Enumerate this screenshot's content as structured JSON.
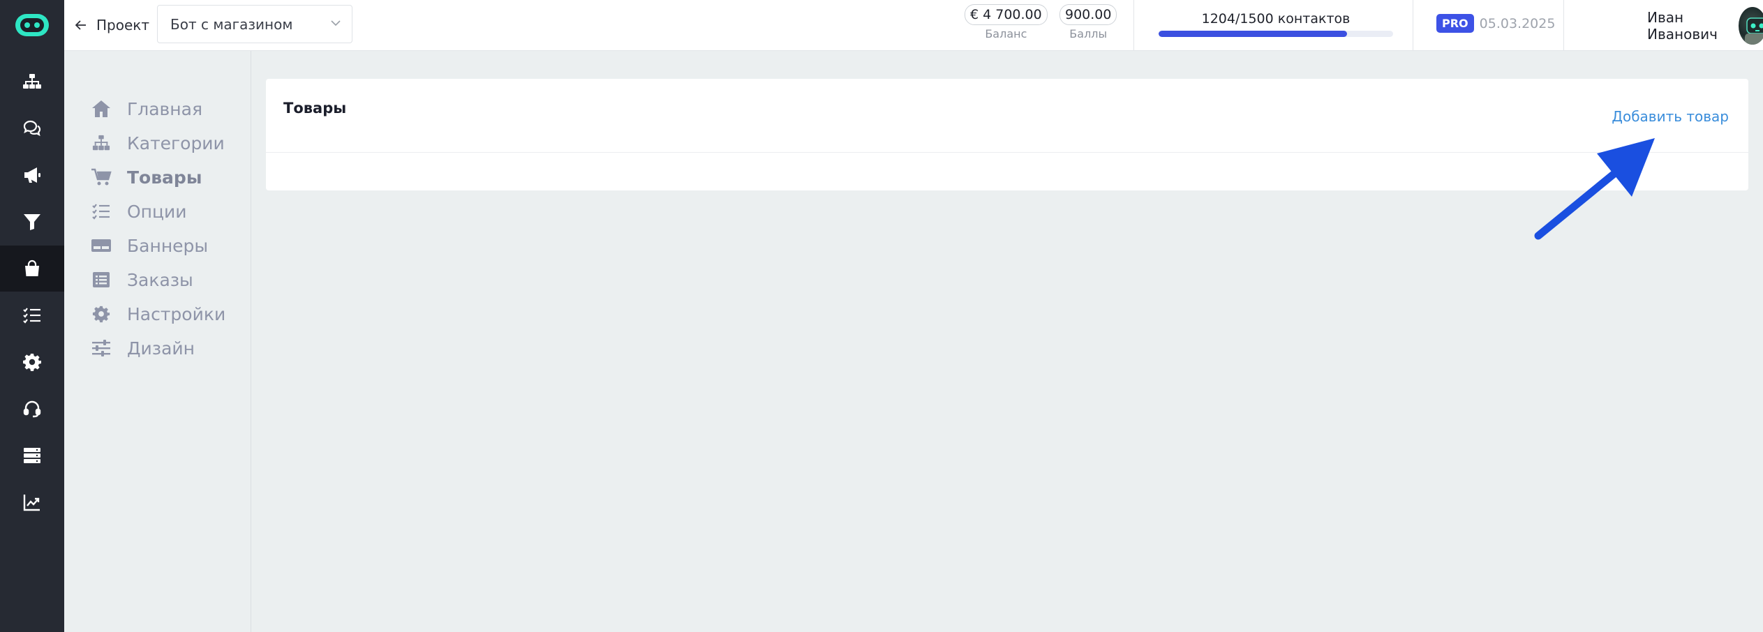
{
  "header": {
    "back_label": "Проект",
    "project_select_value": "Бот с магазином",
    "balance": {
      "value": "€ 4 700.00",
      "caption": "Баланс"
    },
    "points": {
      "value": "900.00",
      "caption": "Баллы"
    },
    "contacts": {
      "label": "1204/1500 контактов",
      "used": 1204,
      "limit": 1500
    },
    "plan": {
      "badge": "PRO",
      "date": "05.03.2025"
    },
    "user": {
      "name": "Иван Иванович"
    }
  },
  "rail": {
    "items": [
      {
        "icon": "sitemap-icon"
      },
      {
        "icon": "chat-icon"
      },
      {
        "icon": "megaphone-icon"
      },
      {
        "icon": "funnel-icon"
      },
      {
        "icon": "shopping-bag-icon",
        "active": true
      },
      {
        "icon": "checklist-icon"
      },
      {
        "icon": "gear-icon"
      },
      {
        "icon": "headset-icon"
      },
      {
        "icon": "server-icon"
      },
      {
        "icon": "chart-line-icon"
      }
    ]
  },
  "subnav": {
    "items": [
      {
        "label": "Главная",
        "icon": "home-icon"
      },
      {
        "label": "Категории",
        "icon": "sitemap-icon"
      },
      {
        "label": "Товары",
        "icon": "cart-icon",
        "active": true
      },
      {
        "label": "Опции",
        "icon": "checklist-icon"
      },
      {
        "label": "Баннеры",
        "icon": "banner-icon"
      },
      {
        "label": "Заказы",
        "icon": "list-icon"
      },
      {
        "label": "Настройки",
        "icon": "gear-icon"
      },
      {
        "label": "Дизайн",
        "icon": "sliders-icon"
      }
    ]
  },
  "main": {
    "title": "Товары",
    "add_label": "Добавить товар"
  },
  "colors": {
    "accent": "#3b50e0",
    "link": "#3a8ddb",
    "rail_bg": "#262a33",
    "logo": "#2ee6c4",
    "arrow": "#1a4fe0"
  }
}
